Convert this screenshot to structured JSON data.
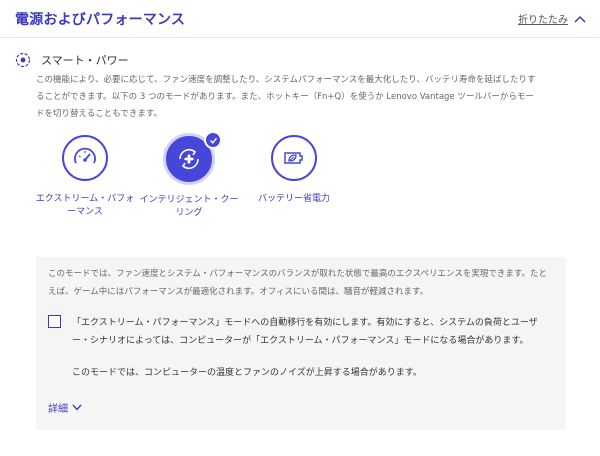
{
  "header": {
    "title": "電源およびパフォーマンス",
    "collapse_label": "折りたたみ"
  },
  "smart_power": {
    "title": "スマート・パワー",
    "description": "この機能により、必要に応じて、ファン速度を調整したり、システムパフォーマンスを最大化したり、バッテリ寿命を延ばしたりすることができます。以下の 3 つのモードがあります。また、ホットキー（Fn+Q）を使うか Lenovo Vantage ツールバーからモードを切り替えることもできます。",
    "modes": [
      {
        "label": "エクストリーム・パフォーマンス",
        "icon": "speedometer-icon",
        "selected": false
      },
      {
        "label": "インテリジェント・クーリング",
        "icon": "fan-cooling-icon",
        "selected": true
      },
      {
        "label": "バッテリー省電力",
        "icon": "leaf-battery-icon",
        "selected": false
      }
    ]
  },
  "panel": {
    "description": "このモードでは、ファン速度とシステム・パフォーマンスのバランスが取れた状態で最高のエクスペリエンスを実現できます。たとえば、ゲーム中にはパフォーマンスが最適化されます。オフィスにいる間は、騒音が軽減されます。",
    "checkbox_label": "「エクストリーム・パフォーマンス」モードへの自動移行を有効にします。有効にすると、システムの負荷とユーザー・シナリオによっては、コンピューターが「エクストリーム・パフォーマンス」モードになる場合があります。",
    "checkbox_checked": false,
    "note": "このモードでは、コンピューターの温度とファンのノイズが上昇する場合があります。",
    "details_label": "詳細"
  },
  "colors": {
    "accent": "#4646d8",
    "panel_bg": "#f5f5f5"
  }
}
